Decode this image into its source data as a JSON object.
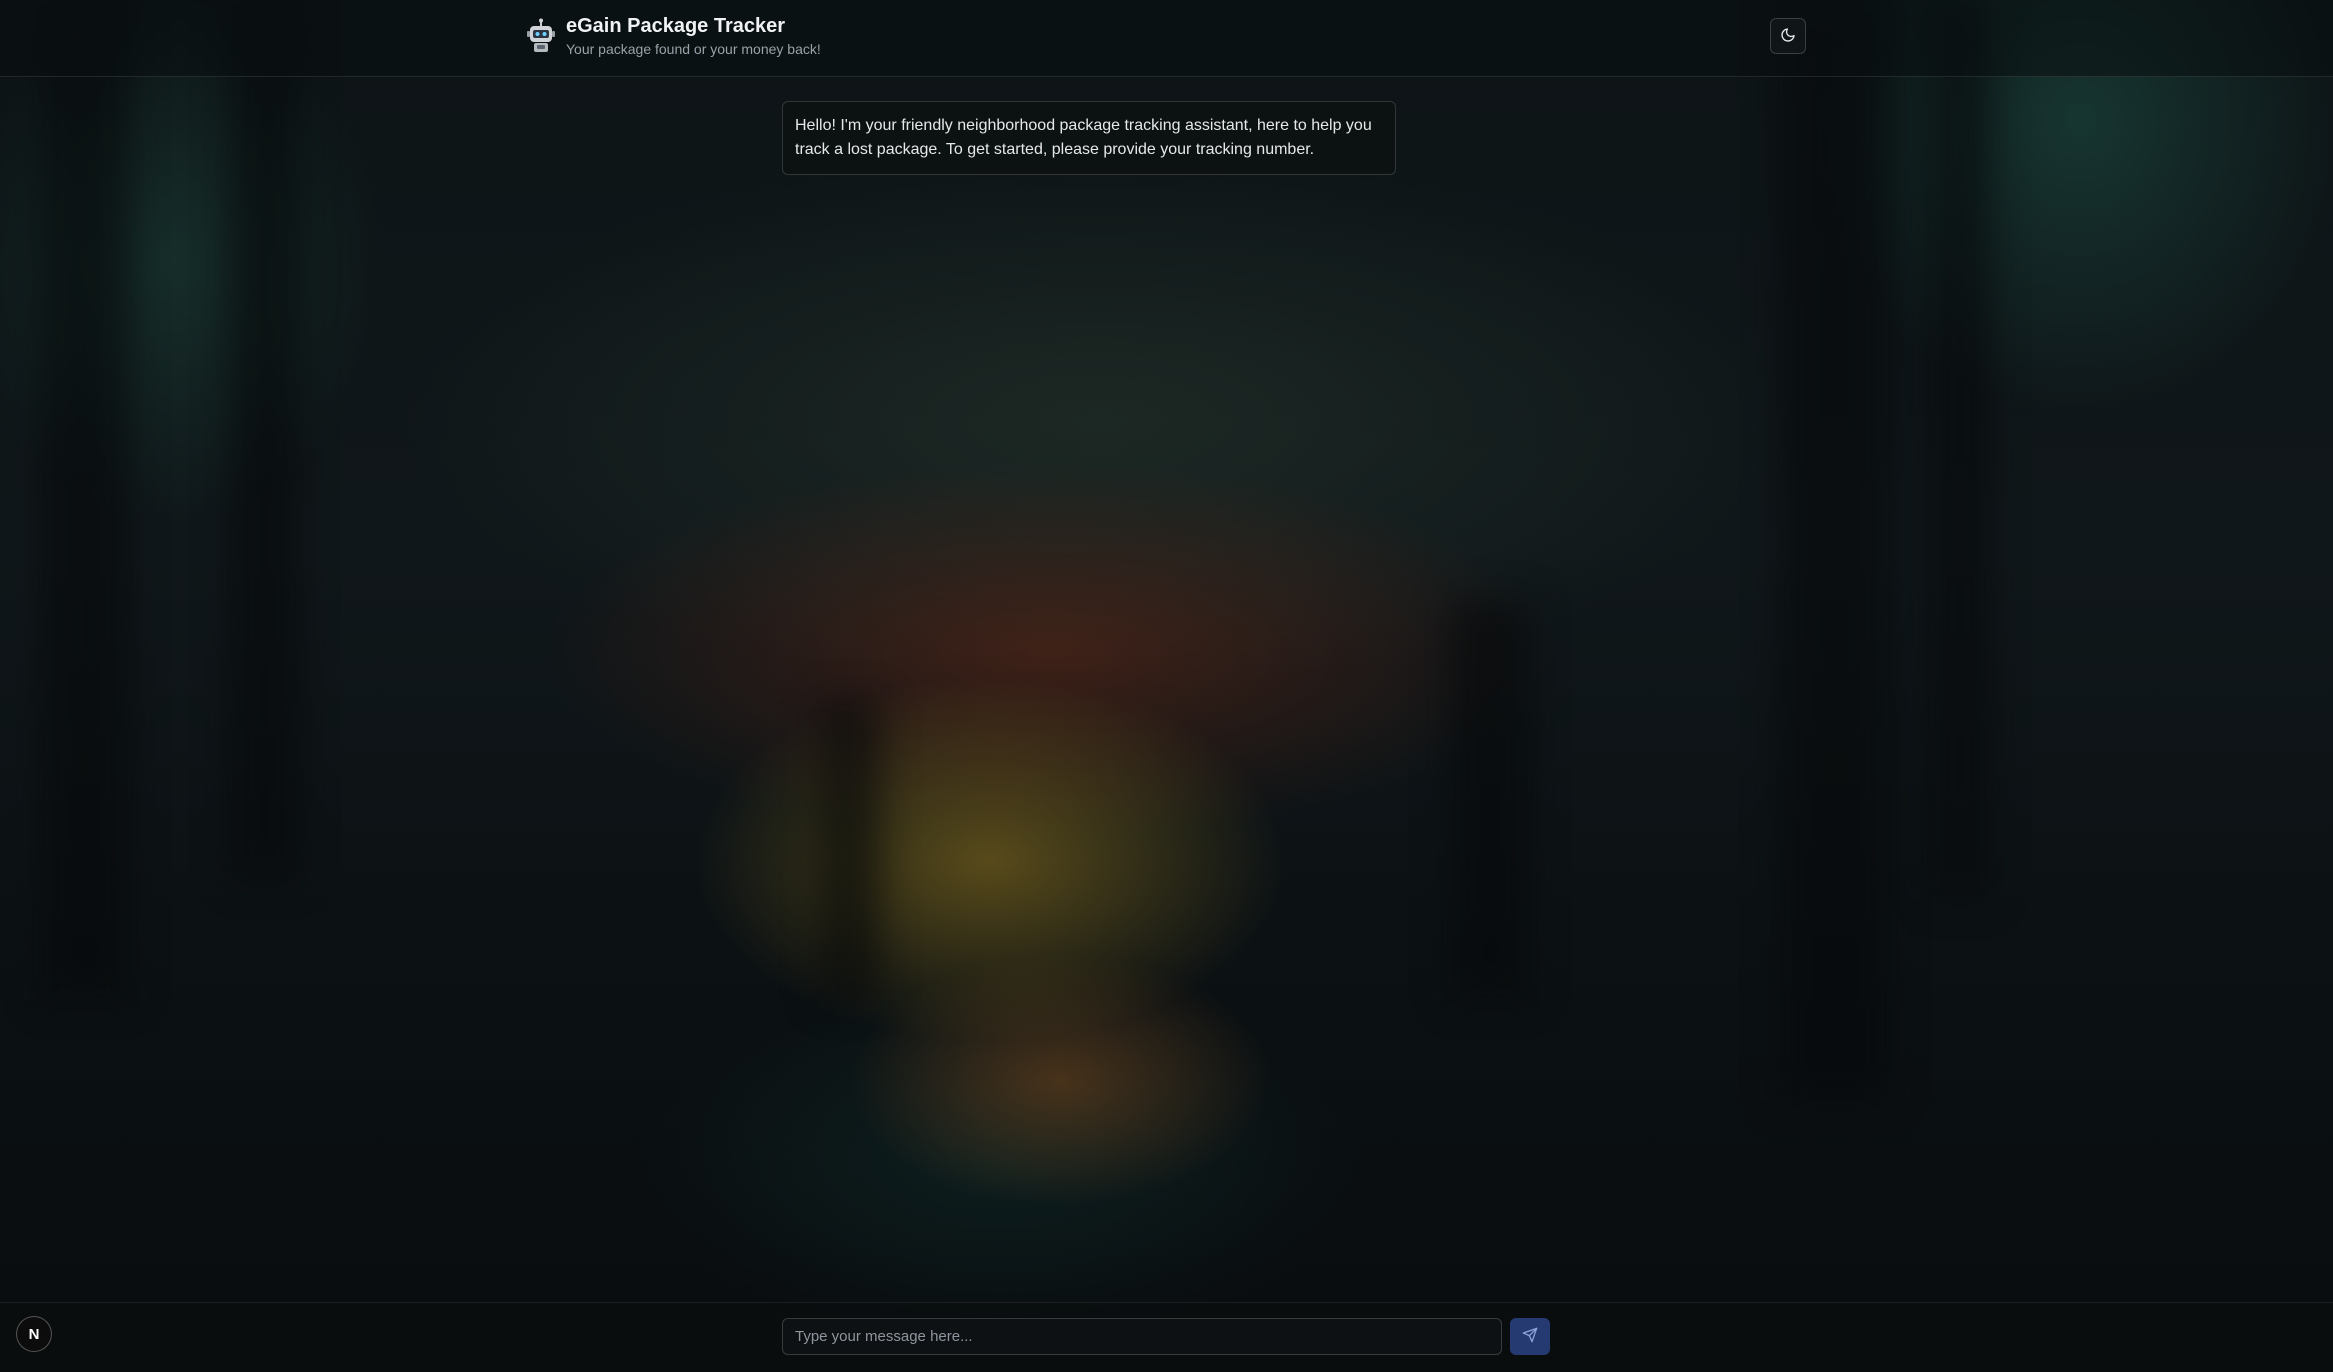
{
  "header": {
    "title": "eGain Package Tracker",
    "subtitle": "Your package found or your money back!",
    "logo_icon": "robot-icon",
    "theme_toggle_icon": "moon-icon"
  },
  "chat": {
    "messages": [
      {
        "role": "assistant",
        "text": "Hello! I'm your friendly neighborhood package tracking assistant, here to help you track a lost package. To get started, please provide your tracking number."
      }
    ]
  },
  "composer": {
    "placeholder": "Type your message here...",
    "value": "",
    "send_icon": "send-icon"
  },
  "badge": {
    "label": "N"
  },
  "colors": {
    "background": "#0b0f12",
    "send_button": "#263a72",
    "text": "#e6e8ea",
    "muted_text": "#9aa1a8"
  }
}
